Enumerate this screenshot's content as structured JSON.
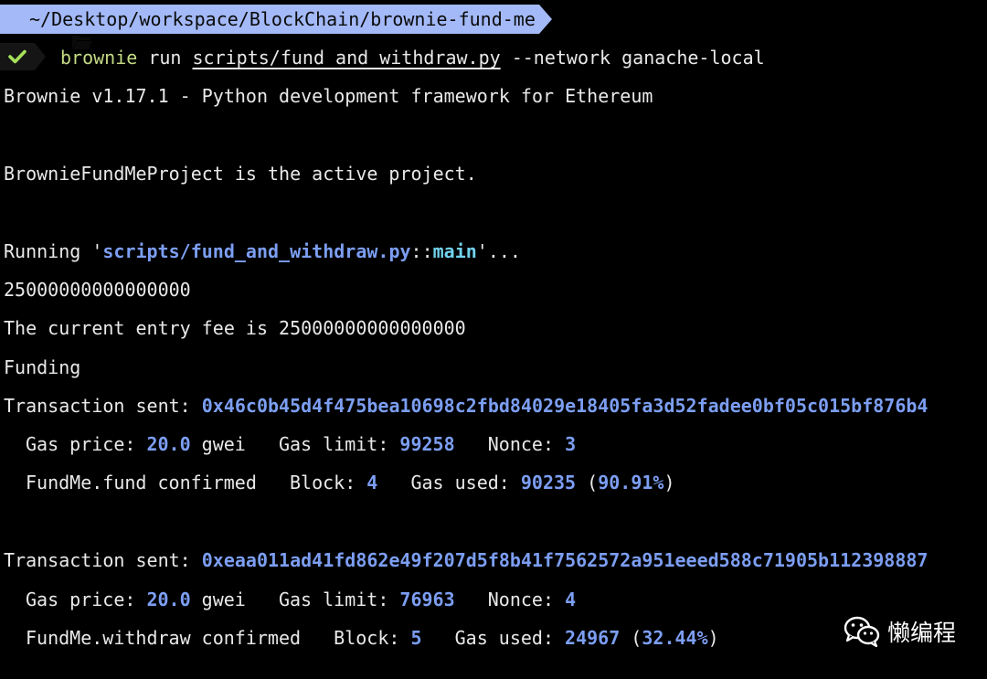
{
  "prompt": {
    "path": "~/Desktop/workspace/BlockChain/brownie-fund-me",
    "status_icon": "check-icon"
  },
  "command": {
    "program": "brownie",
    "subcommand": "run",
    "script_arg": "scripts/fund_and_withdraw.py",
    "options": "--network ganache-local"
  },
  "output": {
    "version_line": "Brownie v1.17.1 - Python development framework for Ethereum",
    "project_line": "BrownieFundMeProject is the active project.",
    "running": {
      "prefix": "Running '",
      "script": "scripts/fund_and_withdraw.py",
      "sep": "::",
      "func": "main",
      "suffix": "'..."
    },
    "value_line": "25000000000000000",
    "entry_fee_line": "The current entry fee is 25000000000000000",
    "funding_line": "Funding",
    "transactions": [
      {
        "label": "Transaction sent: ",
        "hash": "0x46c0b45d4f475bea10698c2fbd84029e18405fa3d52fadee0bf05c015bf876b4",
        "gas_price_label": "Gas price: ",
        "gas_price": "20.0",
        "gas_price_unit": " gwei",
        "gas_limit_label": "Gas limit: ",
        "gas_limit": "99258",
        "nonce_label": "Nonce: ",
        "nonce": "3",
        "confirmed_label": "FundMe.fund confirmed",
        "block_label": "Block: ",
        "block": "4",
        "gas_used_label": "Gas used: ",
        "gas_used": "90235",
        "gas_used_pct": "90.91%"
      },
      {
        "label": "Transaction sent: ",
        "hash": "0xeaa011ad41fd862e49f207d5f8b41f7562572a951eeed588c71905b112398887",
        "gas_price_label": "Gas price: ",
        "gas_price": "20.0",
        "gas_price_unit": " gwei",
        "gas_limit_label": "Gas limit: ",
        "gas_limit": "76963",
        "nonce_label": "Nonce: ",
        "nonce": "4",
        "confirmed_label": "FundMe.withdraw confirmed",
        "block_label": "Block: ",
        "block": "5",
        "gas_used_label": "Gas used: ",
        "gas_used": "24967",
        "gas_used_pct": "32.44%"
      }
    ]
  },
  "watermark": {
    "text": "懒编程",
    "icon": "wechat-icon"
  },
  "colors": {
    "background": "#000000",
    "text": "#e9e9ea",
    "accent_blue": "#7c9ef2",
    "accent_cyan": "#72d3ee",
    "command_green": "#c4da84",
    "path_bg": "#a3b9f8",
    "check_green": "#a6e05a"
  }
}
